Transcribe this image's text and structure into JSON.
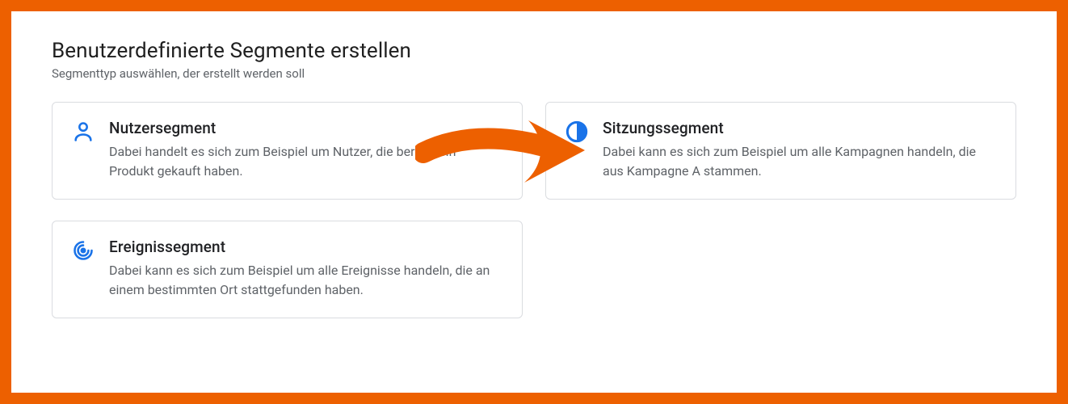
{
  "header": {
    "title": "Benutzerdefinierte Segmente erstellen",
    "subtitle": "Segmenttyp auswählen, der erstellt werden soll"
  },
  "cards": {
    "user": {
      "icon_name": "user-icon",
      "title": "Nutzersegment",
      "description": "Dabei handelt es sich zum Beispiel um Nutzer, die bereits ein Produkt gekauft haben."
    },
    "session": {
      "icon_name": "session-icon",
      "title": "Sitzungssegment",
      "description": "Dabei kann es sich zum Beispiel um alle Kampagnen handeln, die aus Kampagne A stammen."
    },
    "event": {
      "icon_name": "event-icon",
      "title": "Ereignissegment",
      "description": "Dabei kann es sich zum Beispiel um alle Ereignisse handeln, die an einem bestimmten Ort stattgefunden haben."
    }
  },
  "colors": {
    "accent": "#1a73e8",
    "frame": "#ed6000",
    "annotation": "#ed6000",
    "text_primary": "#202124",
    "text_secondary": "#5f6368",
    "border": "#dadce0"
  },
  "annotation": {
    "type": "hand-drawn-arrow",
    "points_to": "session"
  }
}
